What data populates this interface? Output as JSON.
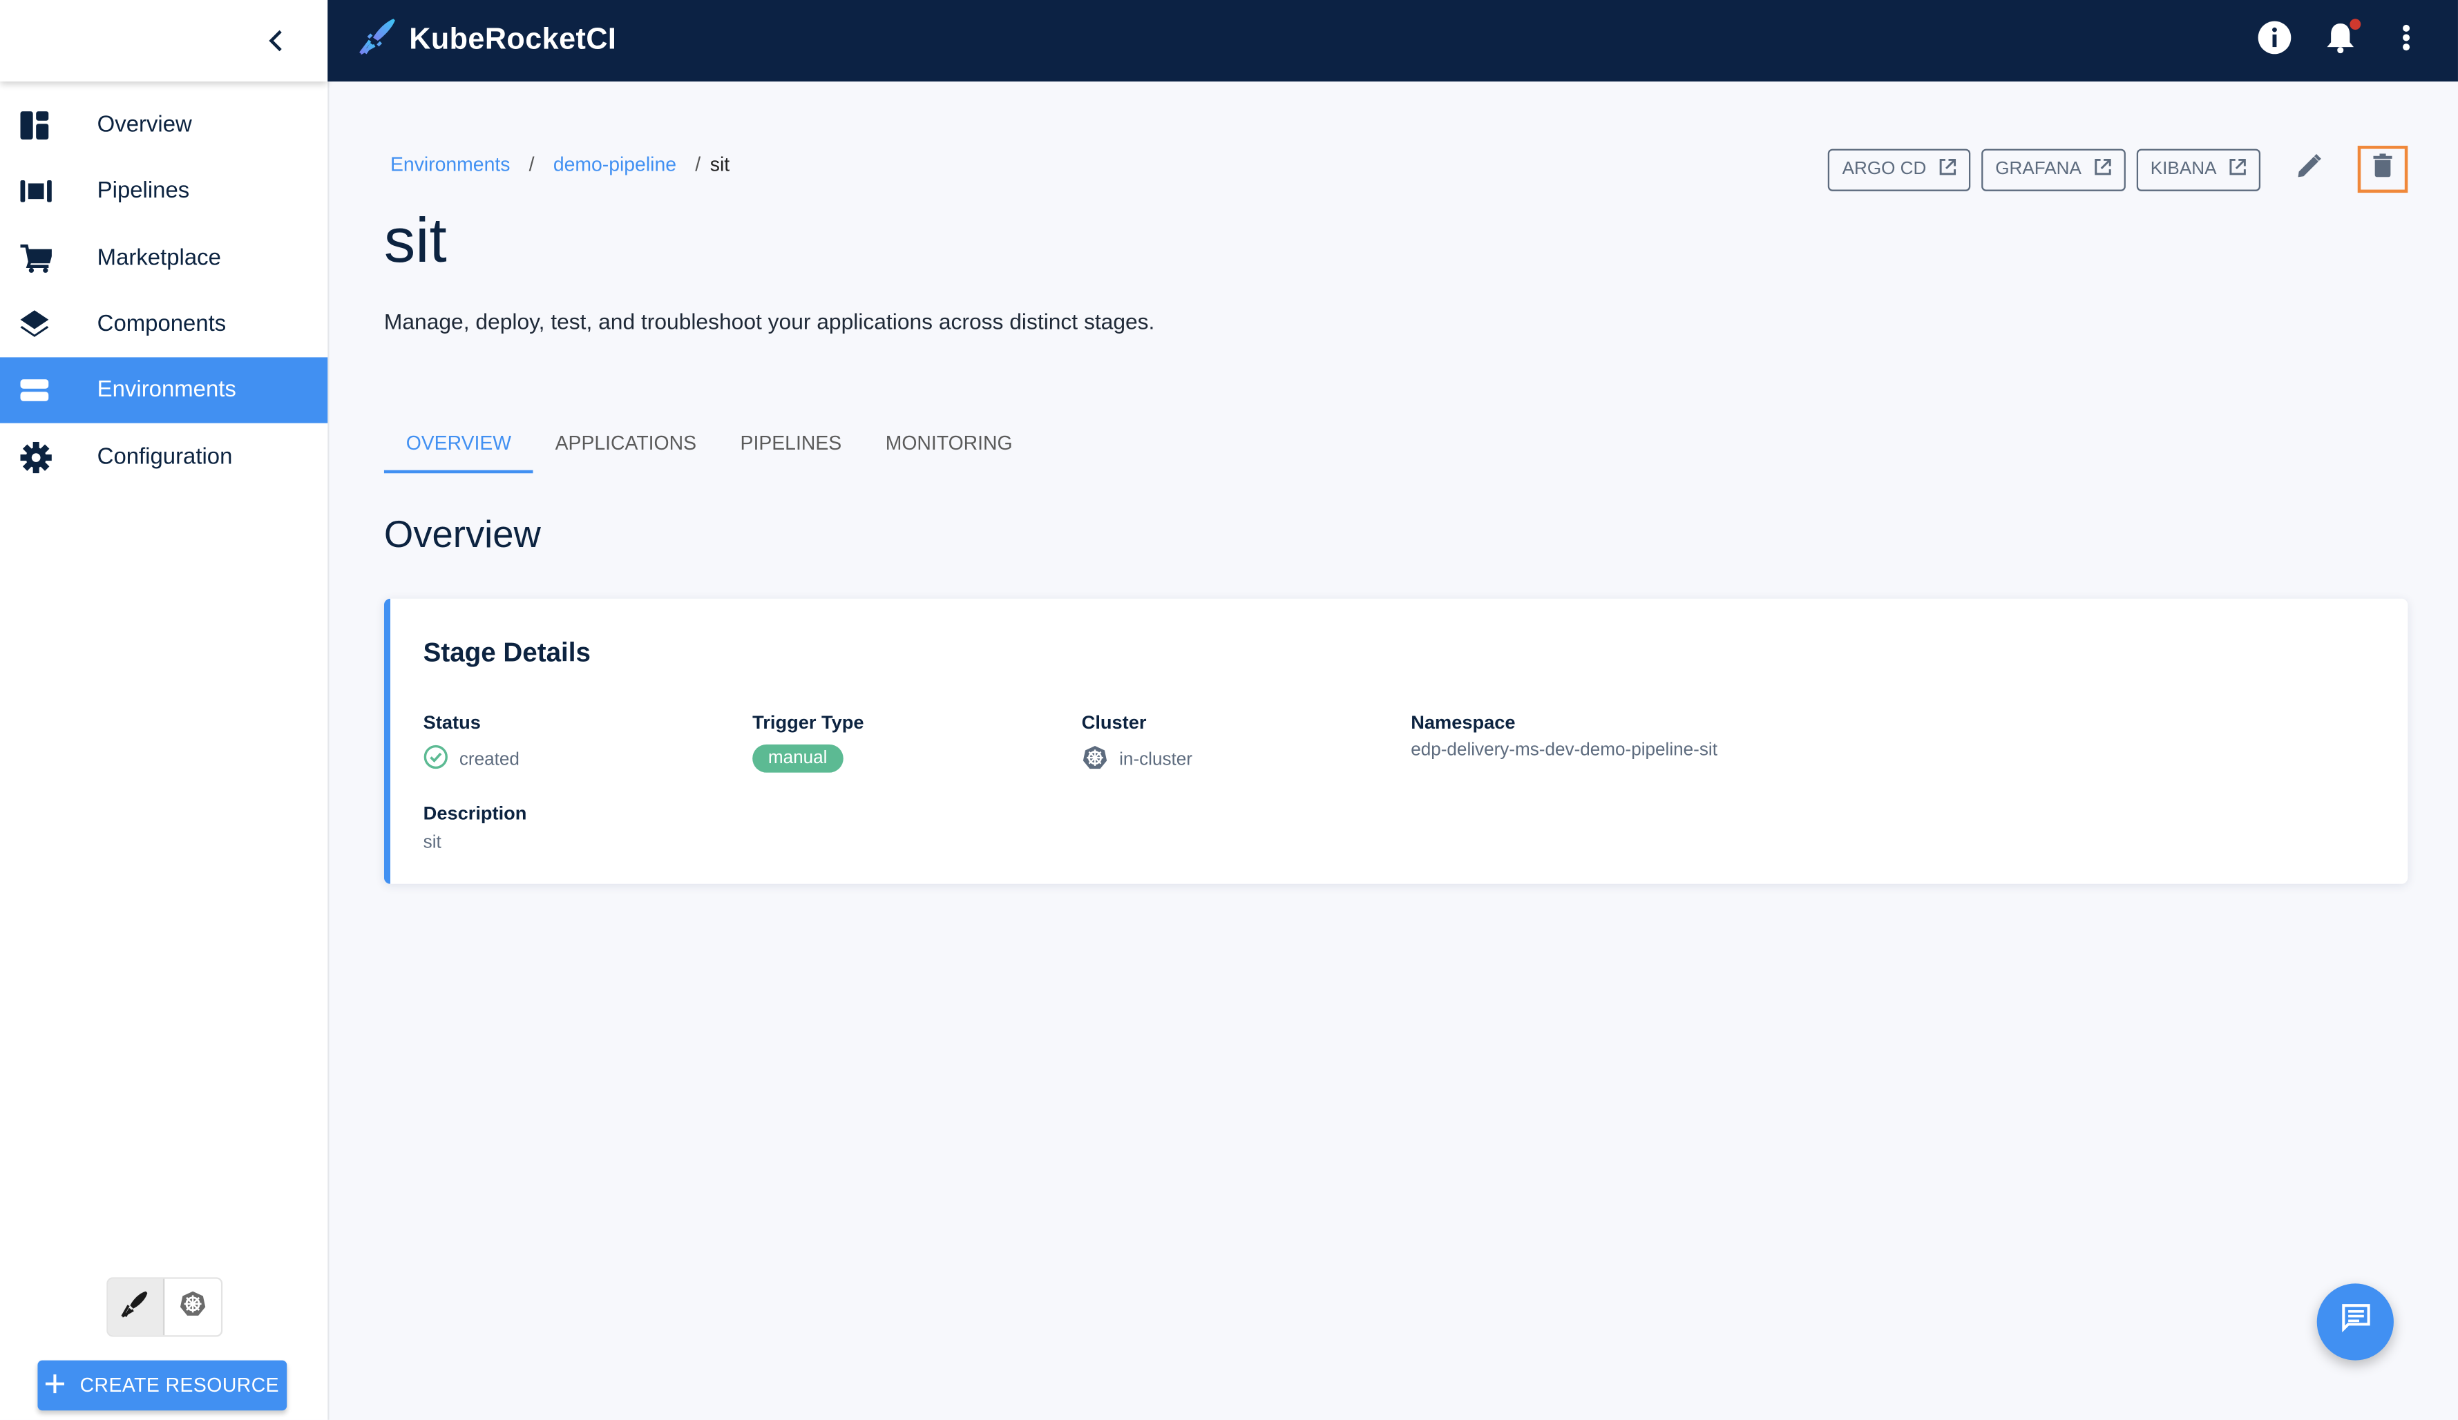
{
  "app": {
    "title": "KubeRocketCI"
  },
  "colors": {
    "topbar": "#0c2244",
    "accent": "#4190f2",
    "chip": "#5cba93",
    "highlight": "#f0883a"
  },
  "topbar": {
    "icons": [
      "info-icon",
      "notifications-icon",
      "more-vert-icon"
    ],
    "has_notification": true
  },
  "sidebar": {
    "collapse_icon": "chevron-left-icon",
    "items": [
      {
        "label": "Overview",
        "icon": "dashboard-icon"
      },
      {
        "label": "Pipelines",
        "icon": "pipelines-icon"
      },
      {
        "label": "Marketplace",
        "icon": "cart-icon"
      },
      {
        "label": "Components",
        "icon": "layers-icon"
      },
      {
        "label": "Environments",
        "icon": "environments-icon",
        "active": true
      },
      {
        "label": "Configuration",
        "icon": "gear-icon"
      }
    ],
    "mode_toggle": [
      "kuberocketci-mode",
      "kubernetes-mode"
    ],
    "create_label": "CREATE RESOURCE"
  },
  "breadcrumb": {
    "items": [
      "Environments",
      "demo-pipeline"
    ],
    "separator": "/",
    "current": "sit"
  },
  "header_actions": {
    "links": [
      "ARGO CD",
      "GRAFANA",
      "KIBANA"
    ]
  },
  "page": {
    "title": "sit",
    "description": "Manage, deploy, test, and troubleshoot your applications across distinct stages."
  },
  "tabs": [
    {
      "label": "OVERVIEW",
      "active": true
    },
    {
      "label": "APPLICATIONS"
    },
    {
      "label": "PIPELINES"
    },
    {
      "label": "MONITORING"
    }
  ],
  "overview": {
    "title": "Overview",
    "card": {
      "title": "Stage Details",
      "status": {
        "label": "Status",
        "value": "created"
      },
      "trigger": {
        "label": "Trigger Type",
        "value": "manual"
      },
      "cluster": {
        "label": "Cluster",
        "value": "in-cluster"
      },
      "namespace": {
        "label": "Namespace",
        "value": "edp-delivery-ms-dev-demo-pipeline-sit"
      },
      "description": {
        "label": "Description",
        "value": "sit"
      }
    }
  }
}
